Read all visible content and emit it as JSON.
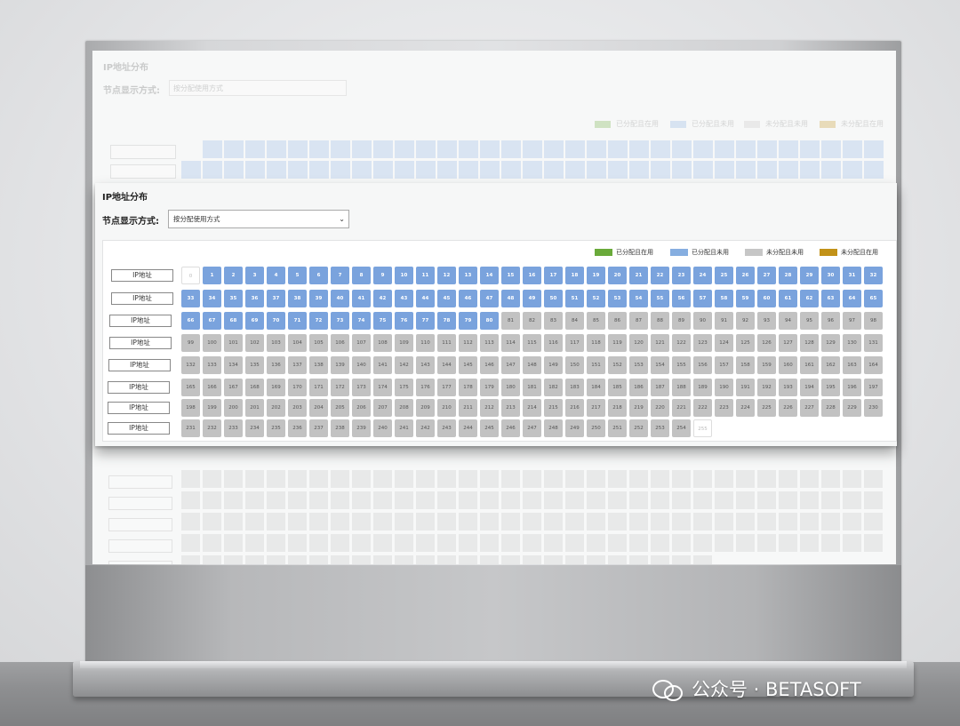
{
  "panel": {
    "title": "IP地址分布",
    "mode_label": "节点显示方式:",
    "mode_select": "按分配使用方式"
  },
  "legend": [
    {
      "label": "已分配且在用",
      "color": "#6aaa3a"
    },
    {
      "label": "已分配且未用",
      "color": "#86aee0"
    },
    {
      "label": "未分配且未用",
      "color": "#c6c6c6"
    },
    {
      "label": "未分配且在用",
      "color": "#c29218"
    }
  ],
  "row_label": "IP地址",
  "grid": {
    "first": 0,
    "last": 255,
    "used_range": [
      1,
      80
    ],
    "free_range": [
      81,
      254
    ],
    "blank_values": [
      0,
      255
    ],
    "columns_first_row": 33,
    "columns_other_rows": 33
  },
  "watermark": {
    "text": "公众号 · BETASOFT",
    "icon": "wechat-icon"
  }
}
